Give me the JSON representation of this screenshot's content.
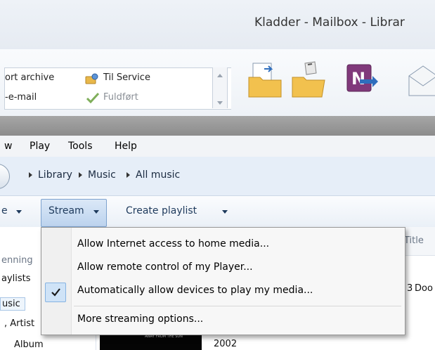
{
  "window": {
    "title": "Kladder - Mailbox - Librar"
  },
  "ribbon": {
    "quick_steps": [
      {
        "label": "ort archive",
        "icon": "folder-icon"
      },
      {
        "label": "Til Service",
        "icon": "team-icon"
      },
      {
        "label": "-e-mail",
        "icon": "mail-icon"
      },
      {
        "label": "Fuldført",
        "icon": "checkmark-icon"
      }
    ],
    "large_icons": [
      "move-to-folder-icon",
      "rules-icon",
      "onenote-icon",
      "envelope-icon"
    ]
  },
  "menubar": {
    "items": [
      {
        "label": "w"
      },
      {
        "label": "Play"
      },
      {
        "label": "Tools"
      },
      {
        "label": "Help"
      }
    ]
  },
  "breadcrumb": {
    "items": [
      "Library",
      "Music",
      "All music"
    ]
  },
  "toolbar": {
    "organize_fragment": "e",
    "stream_label": "Stream",
    "create_playlist_label": "Create playlist"
  },
  "nav": {
    "items": [
      "enning",
      "aylists",
      "usic",
      ", Artist",
      "Album"
    ]
  },
  "content": {
    "column_title": "Title",
    "row_fragment": "Doo",
    "row_digit": "3",
    "year": "2002",
    "album_art_text": "AWAY FROM THE SUN"
  },
  "dropdown": {
    "items": [
      {
        "label": "Allow Internet access to home media...",
        "checked": false
      },
      {
        "label": "Allow remote control of my Player...",
        "checked": false
      },
      {
        "label": "Automatically allow devices to play my media...",
        "checked": true
      },
      {
        "label": "More streaming options...",
        "checked": false
      }
    ]
  },
  "colors": {
    "accent": "#2f6ebd",
    "stream_active_bg": "#cfe0f5",
    "onenote_purple": "#80397b",
    "folder_yellow": "#f2c14e"
  }
}
